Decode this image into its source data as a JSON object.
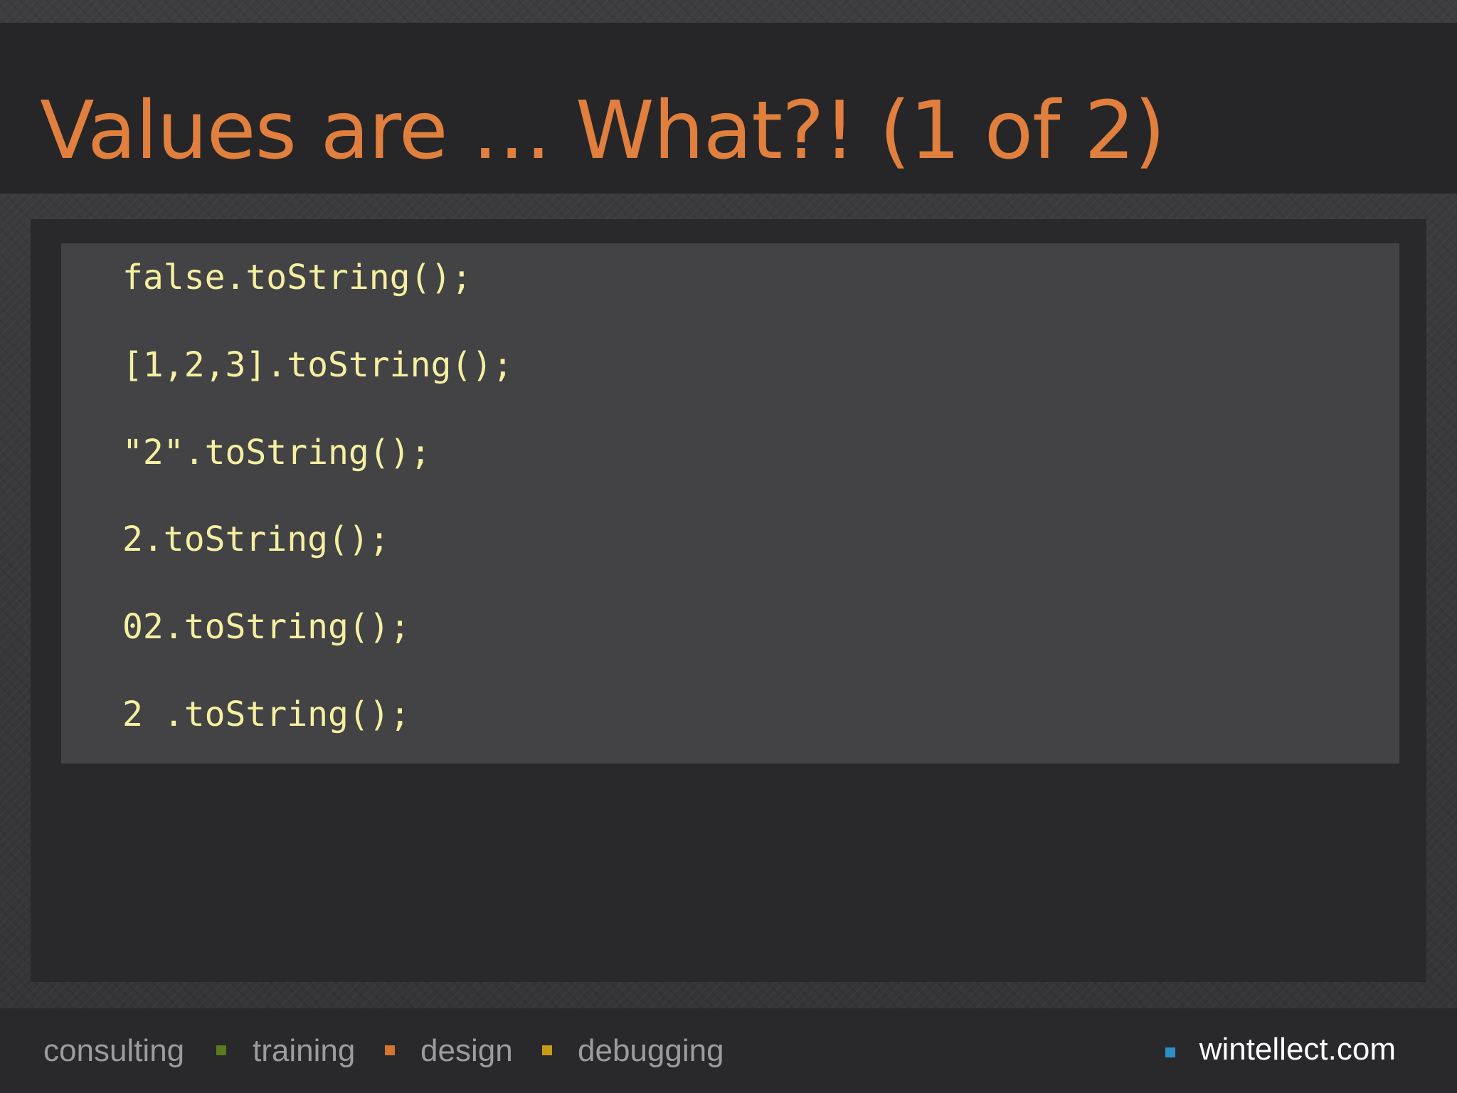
{
  "slide": {
    "title": "Values are … What?! (1 of 2)",
    "title_color": "#e07f3e"
  },
  "code": {
    "text_color": "#f4f0a0",
    "lines": [
      "false.toString();",
      "[1,2,3].toString();",
      "\"2\".toString();",
      "2.toString();",
      "02.toString();",
      "2 .toString();"
    ]
  },
  "footer": {
    "items": [
      {
        "label": "consulting"
      },
      {
        "label": "training",
        "bullet_color": "#5a7a1e"
      },
      {
        "label": "design",
        "bullet_color": "#d5732f"
      },
      {
        "label": "debugging",
        "bullet_color": "#c99a14"
      }
    ],
    "site": {
      "label": "wintellect.com",
      "bullet_color": "#2d8fc6",
      "text_color": "#ffffff"
    }
  }
}
